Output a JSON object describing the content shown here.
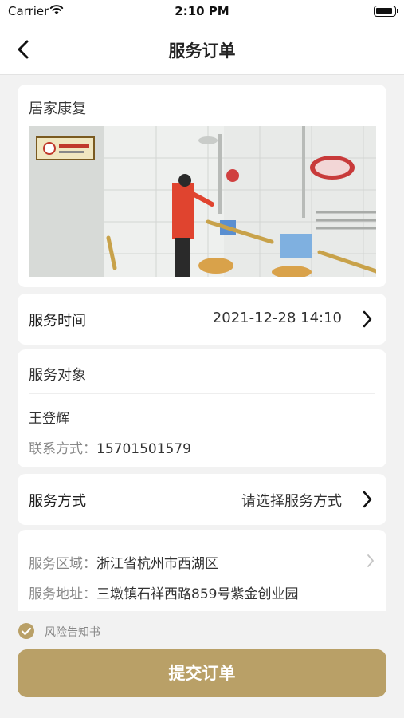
{
  "status_bar": {
    "carrier": "Carrier",
    "time": "2:10 PM"
  },
  "nav": {
    "title": "服务订单",
    "back_icon": "chevron-left-icon"
  },
  "service": {
    "name": "居家康复",
    "photo_description_icon": "service-photo"
  },
  "service_time": {
    "label": "服务时间",
    "value": "2021-12-28 14:10"
  },
  "target": {
    "title": "服务对象",
    "name": "王登辉",
    "contact_label": "联系方式：",
    "contact_value": "15701501579"
  },
  "method": {
    "label": "服务方式",
    "placeholder": "请选择服务方式"
  },
  "address": {
    "region_label": "服务区域：",
    "region_value": "浙江省杭州市西湖区",
    "address_label": "服务地址：",
    "address_value": "三墩镇石祥西路859号紫金创业园"
  },
  "risk": {
    "label": "风险告知书",
    "checked": true
  },
  "submit": {
    "label": "提交订单"
  },
  "colors": {
    "accent": "#b9a067",
    "background": "#f2f2f2",
    "card": "#ffffff"
  }
}
